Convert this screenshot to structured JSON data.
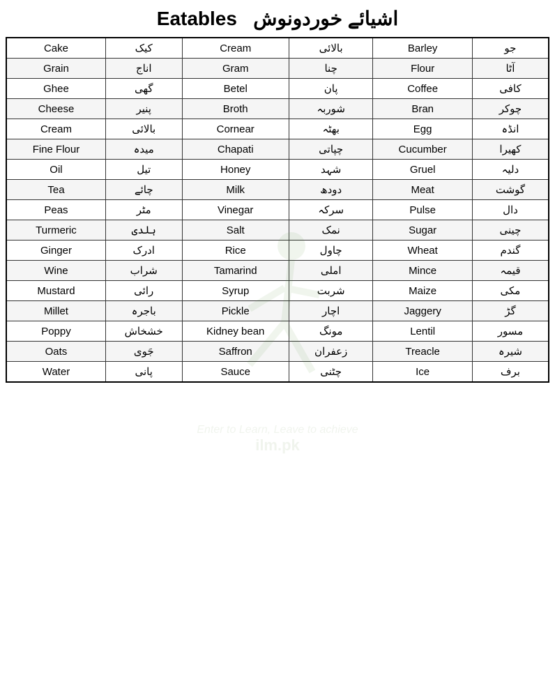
{
  "page": {
    "title_urdu": "اشیائے خوردونوش",
    "title_english": "Eatables",
    "watermark_tagline": "Enter to Learn, Leave to achieve",
    "watermark_domain": "ilm.pk"
  },
  "table": {
    "rows": [
      {
        "e1": "Cake",
        "u1": "کیک",
        "e2": "Cream",
        "u2": "بالائی",
        "e3": "Barley",
        "u3": "جو"
      },
      {
        "e1": "Grain",
        "u1": "اناج",
        "e2": "Gram",
        "u2": "چنا",
        "e3": "Flour",
        "u3": "آٹا"
      },
      {
        "e1": "Ghee",
        "u1": "گھی",
        "e2": "Betel",
        "u2": "پان",
        "e3": "Coffee",
        "u3": "کافی"
      },
      {
        "e1": "Cheese",
        "u1": "پنیر",
        "e2": "Broth",
        "u2": "شوربہ",
        "e3": "Bran",
        "u3": "چوکر"
      },
      {
        "e1": "Cream",
        "u1": "بالائی",
        "e2": "Cornear",
        "u2": "بھٹہ",
        "e3": "Egg",
        "u3": "انڈہ"
      },
      {
        "e1": "Fine Flour",
        "u1": "میدہ",
        "e2": "Chapati",
        "u2": "چپاتی",
        "e3": "Cucumber",
        "u3": "کھیرا"
      },
      {
        "e1": "Oil",
        "u1": "تیل",
        "e2": "Honey",
        "u2": "شہد",
        "e3": "Gruel",
        "u3": "دلیہ"
      },
      {
        "e1": "Tea",
        "u1": "چائے",
        "e2": "Milk",
        "u2": "دودھ",
        "e3": "Meat",
        "u3": "گوشت"
      },
      {
        "e1": "Peas",
        "u1": "مٹر",
        "e2": "Vinegar",
        "u2": "سرکہ",
        "e3": "Pulse",
        "u3": "دال"
      },
      {
        "e1": "Turmeric",
        "u1": "ہلدی",
        "e2": "Salt",
        "u2": "نمک",
        "e3": "Sugar",
        "u3": "چینی"
      },
      {
        "e1": "Ginger",
        "u1": "ادرک",
        "e2": "Rice",
        "u2": "چاول",
        "e3": "Wheat",
        "u3": "گندم"
      },
      {
        "e1": "Wine",
        "u1": "شراب",
        "e2": "Tamarind",
        "u2": "املی",
        "e3": "Mince",
        "u3": "قیمہ"
      },
      {
        "e1": "Mustard",
        "u1": "رائی",
        "e2": "Syrup",
        "u2": "شربت",
        "e3": "Maize",
        "u3": "مکی"
      },
      {
        "e1": "Millet",
        "u1": "باجرہ",
        "e2": "Pickle",
        "u2": "اچار",
        "e3": "Jaggery",
        "u3": "گڑ"
      },
      {
        "e1": "Poppy",
        "u1": "خشخاش",
        "e2": "Kidney bean",
        "u2": "مونگ",
        "e3": "Lentil",
        "u3": "مسور"
      },
      {
        "e1": "Oats",
        "u1": "جَوی",
        "e2": "Saffron",
        "u2": "زعفران",
        "e3": "Treacle",
        "u3": "شیرہ"
      },
      {
        "e1": "Water",
        "u1": "پانی",
        "e2": "Sauce",
        "u2": "چٹنی",
        "e3": "Ice",
        "u3": "برف"
      }
    ]
  }
}
